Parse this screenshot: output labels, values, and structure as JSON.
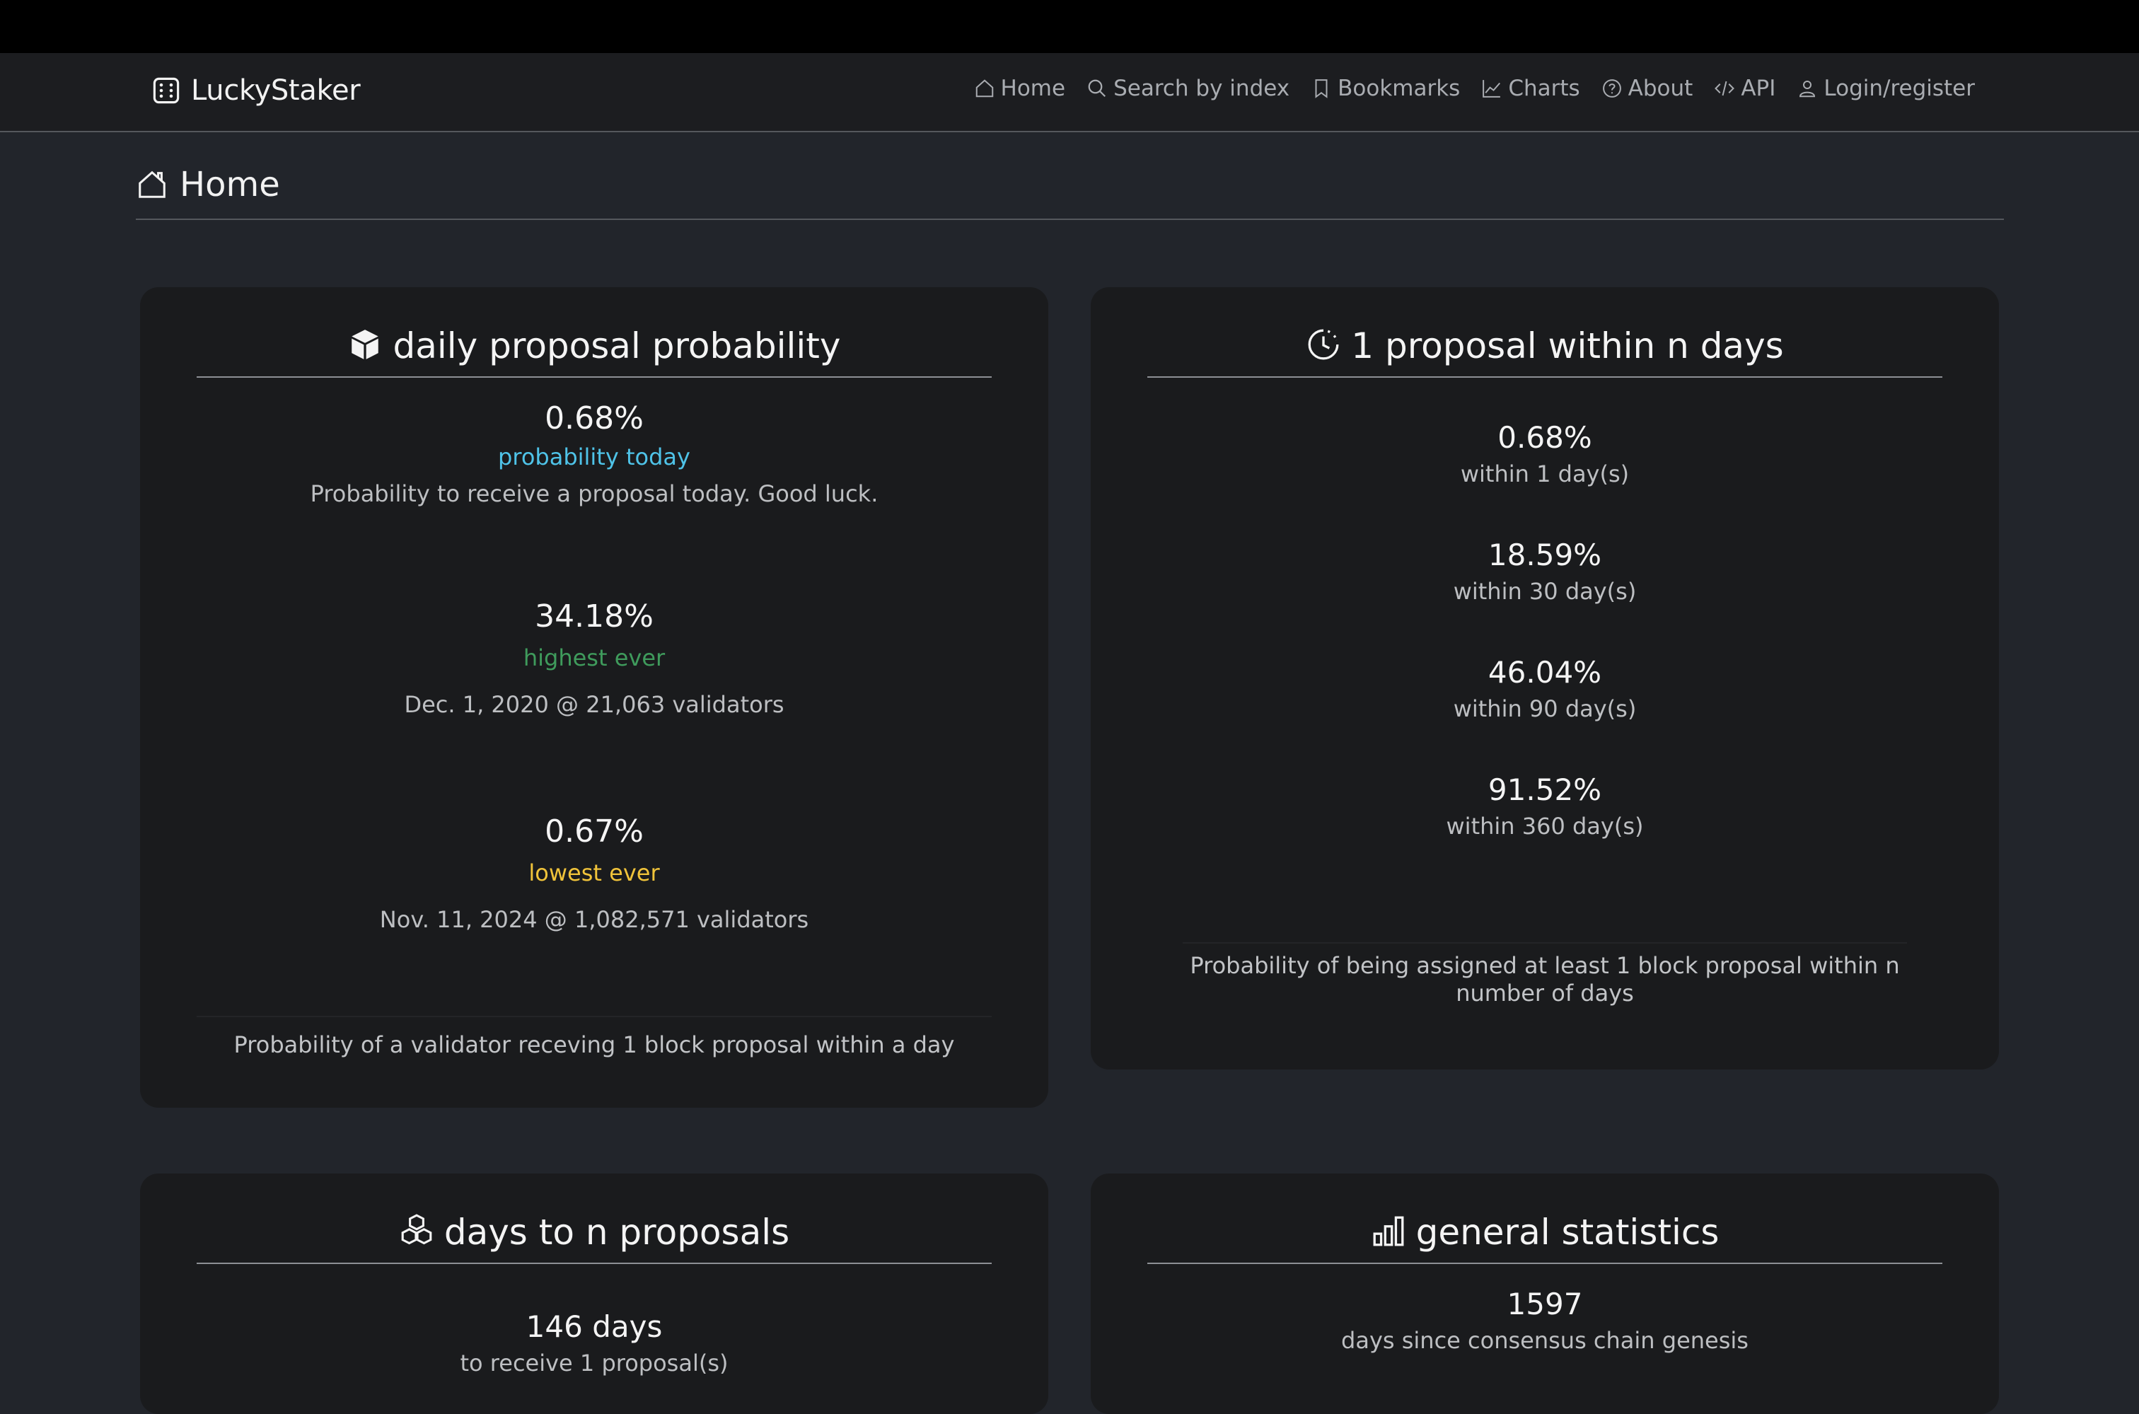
{
  "brand": {
    "name": "LuckyStaker"
  },
  "nav": [
    {
      "label": "Home",
      "icon": "home-icon"
    },
    {
      "label": "Search by index",
      "icon": "search-icon"
    },
    {
      "label": "Bookmarks",
      "icon": "bookmark-icon"
    },
    {
      "label": "Charts",
      "icon": "chart-icon"
    },
    {
      "label": "About",
      "icon": "question-circle-icon"
    },
    {
      "label": "API",
      "icon": "code-icon"
    },
    {
      "label": "Login/register",
      "icon": "user-icon"
    }
  ],
  "page": {
    "title": "Home"
  },
  "daily": {
    "title": "daily proposal probability",
    "today_value": "0.68%",
    "today_label": "probability today",
    "today_desc": "Probability to receive a proposal today. Good luck.",
    "high_value": "34.18%",
    "high_label": "highest ever",
    "high_desc": "Dec. 1, 2020 @ 21,063 validators",
    "low_value": "0.67%",
    "low_label": "lowest ever",
    "low_desc": "Nov. 11, 2024 @ 1,082,571 validators",
    "footer": "Probability of a validator receving 1 block proposal within a day"
  },
  "within": {
    "title": "1 proposal within n days",
    "items": [
      {
        "value": "0.68%",
        "label": "within 1 day(s)"
      },
      {
        "value": "18.59%",
        "label": "within 30 day(s)"
      },
      {
        "value": "46.04%",
        "label": "within 90 day(s)"
      },
      {
        "value": "91.52%",
        "label": "within 360 day(s)"
      }
    ],
    "footer": "Probability of being assigned at least 1 block proposal within n number of days"
  },
  "days_to_n": {
    "title": "days to n proposals",
    "value": "146 days",
    "label": "to receive 1 proposal(s)"
  },
  "general": {
    "title": "general statistics",
    "value": "1597",
    "label": "days since consensus chain genesis"
  },
  "colors": {
    "today_label": "#4fc3e8",
    "high_label": "#3f9b5c",
    "low_label": "#f0c33a"
  }
}
